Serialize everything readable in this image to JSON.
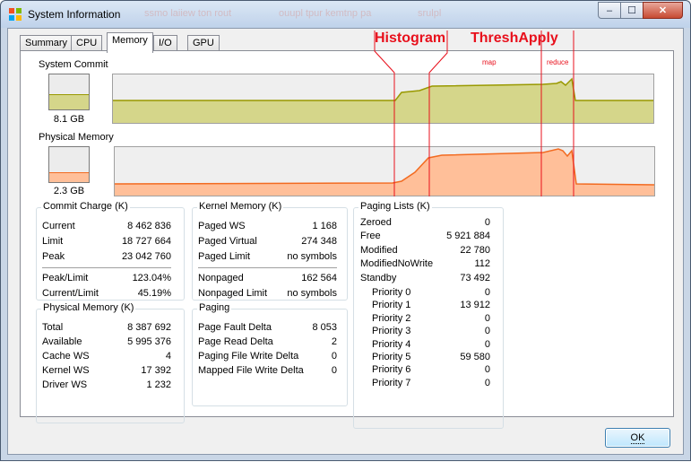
{
  "window": {
    "title": "System Information",
    "ghost_texts": [
      "ssmo laiiew ton rout",
      "ouupl tpur kemtnp pa",
      "srulpl"
    ]
  },
  "caption_buttons": {
    "minimize": "–",
    "maximize": "☐",
    "close": "✕"
  },
  "tabs": [
    "Summary",
    "CPU",
    "Memory",
    "I/O",
    "GPU"
  ],
  "active_tab": "Memory",
  "graphs": {
    "system_commit": {
      "label": "System Commit",
      "value": "8.1 GB",
      "color_fill": "#d5d68a",
      "color_line": "#999900",
      "mini_level": 0.43
    },
    "physical_memory": {
      "label": "Physical Memory",
      "value": "2.3 GB",
      "color_fill": "#ffbf99",
      "color_line": "#f26b21",
      "mini_level": 0.28
    }
  },
  "commit_charge": {
    "title": "Commit Charge (K)",
    "rows": [
      {
        "label": "Current",
        "value": "8 462 836"
      },
      {
        "label": "Limit",
        "value": "18 727 664"
      },
      {
        "label": "Peak",
        "value": "23 042 760"
      }
    ],
    "rows2": [
      {
        "label": "Peak/Limit",
        "value": "123.04%"
      },
      {
        "label": "Current/Limit",
        "value": "45.19%"
      }
    ]
  },
  "physical_memory": {
    "title": "Physical Memory (K)",
    "rows": [
      {
        "label": "Total",
        "value": "8 387 692"
      },
      {
        "label": "Available",
        "value": "5 995 376"
      },
      {
        "label": "Cache WS",
        "value": "4"
      },
      {
        "label": "Kernel WS",
        "value": "17 392"
      },
      {
        "label": "Driver WS",
        "value": "1 232"
      }
    ]
  },
  "kernel_memory": {
    "title": "Kernel Memory (K)",
    "rows": [
      {
        "label": "Paged WS",
        "value": "1 168"
      },
      {
        "label": "Paged Virtual",
        "value": "274 348"
      },
      {
        "label": "Paged Limit",
        "value": "no symbols"
      }
    ],
    "rows2": [
      {
        "label": "Nonpaged",
        "value": "162 564"
      },
      {
        "label": "Nonpaged Limit",
        "value": "no symbols"
      }
    ]
  },
  "paging": {
    "title": "Paging",
    "rows": [
      {
        "label": "Page Fault Delta",
        "value": "8 053"
      },
      {
        "label": "Page Read Delta",
        "value": "2"
      },
      {
        "label": "Paging File Write Delta",
        "value": "0"
      },
      {
        "label": "Mapped File Write Delta",
        "value": "0"
      }
    ]
  },
  "paging_lists": {
    "title": "Paging Lists (K)",
    "rows": [
      {
        "label": "Zeroed",
        "value": "0"
      },
      {
        "label": "Free",
        "value": "5 921 884"
      },
      {
        "label": "Modified",
        "value": "22 780"
      },
      {
        "label": "ModifiedNoWrite",
        "value": "112"
      },
      {
        "label": "Standby",
        "value": "73 492"
      }
    ],
    "priorities": [
      {
        "label": "Priority 0",
        "value": "0"
      },
      {
        "label": "Priority 1",
        "value": "13 912"
      },
      {
        "label": "Priority 2",
        "value": "0"
      },
      {
        "label": "Priority 3",
        "value": "0"
      },
      {
        "label": "Priority 4",
        "value": "0"
      },
      {
        "label": "Priority 5",
        "value": "59 580"
      },
      {
        "label": "Priority 6",
        "value": "0"
      },
      {
        "label": "Priority 7",
        "value": "0"
      }
    ]
  },
  "ok_button": "OK",
  "annotations": {
    "histogram": "Histogram",
    "threshapply": "ThreshApply",
    "map": "map",
    "reduce": "reduce",
    "color": "#e8101c"
  }
}
